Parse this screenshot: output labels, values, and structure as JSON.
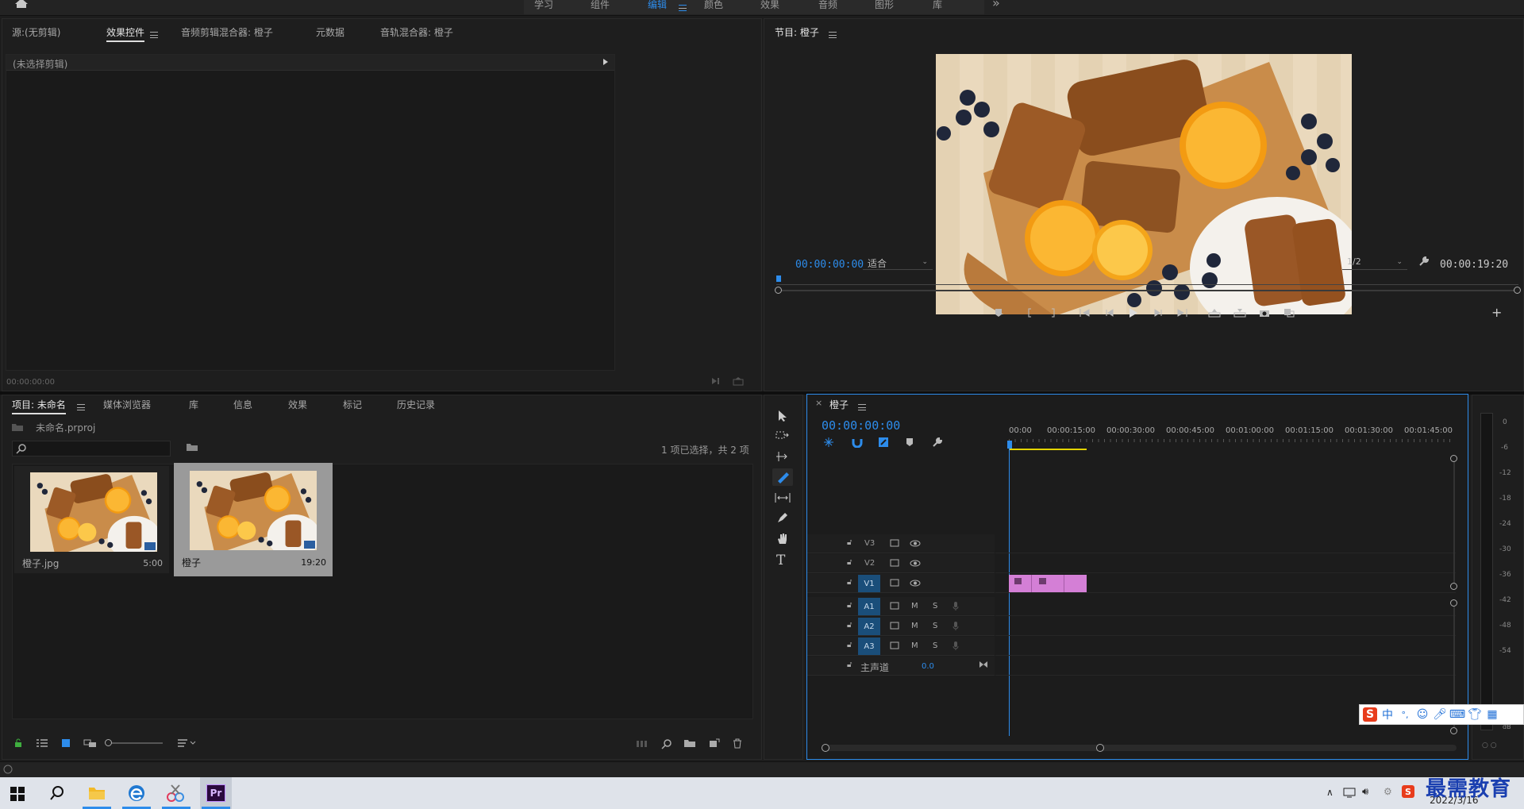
{
  "workspace": {
    "tabs": [
      {
        "label": "学习"
      },
      {
        "label": "组件"
      },
      {
        "label": "编辑"
      },
      {
        "label": "颜色"
      },
      {
        "label": "效果"
      },
      {
        "label": "音频"
      },
      {
        "label": "图形"
      },
      {
        "label": "库"
      }
    ],
    "overflow_label": "»"
  },
  "source_panel": {
    "tabs": [
      {
        "label": "源:(无剪辑)"
      },
      {
        "label": "效果控件"
      },
      {
        "label": "音频剪辑混合器: 橙子"
      },
      {
        "label": "元数据"
      },
      {
        "label": "音轨混合器: 橙子"
      }
    ],
    "no_clip_label": "(未选择剪辑)",
    "timecode": "00:00:00:00"
  },
  "program_monitor": {
    "title": "节目: 橙子",
    "timecode_current": "00:00:00:00",
    "fit_label": "适合",
    "resolution_label": "1/2",
    "timecode_duration": "00:00:19:20"
  },
  "project_panel": {
    "tabs": [
      {
        "label": "项目: 未命名"
      },
      {
        "label": "媒体浏览器"
      },
      {
        "label": "库"
      },
      {
        "label": "信息"
      },
      {
        "label": "效果"
      },
      {
        "label": "标记"
      },
      {
        "label": "历史记录"
      }
    ],
    "project_file": "未命名.prproj",
    "search_placeholder": "",
    "selection_status": "1 项已选择，共 2 项",
    "items": [
      {
        "name": "橙子.jpg",
        "duration": "5:00"
      },
      {
        "name": "橙子",
        "duration": "19:20"
      }
    ]
  },
  "timeline": {
    "sequence_name": "橙子",
    "timecode": "00:00:00:00",
    "ruler": [
      "00:00",
      "00:00:15:00",
      "00:00:30:00",
      "00:00:45:00",
      "00:01:00:00",
      "00:01:15:00",
      "00:01:30:00",
      "00:01:45:00"
    ],
    "video_tracks": [
      {
        "name": "V3"
      },
      {
        "name": "V2"
      },
      {
        "name": "V1"
      }
    ],
    "audio_tracks": [
      {
        "name": "A1",
        "m": "M",
        "s": "S"
      },
      {
        "name": "A2",
        "m": "M",
        "s": "S"
      },
      {
        "name": "A3",
        "m": "M",
        "s": "S"
      }
    ],
    "master": {
      "label": "主声道",
      "value": "0.0"
    },
    "clip_color": "#d47fd6"
  },
  "audio_meter": {
    "scale": [
      "0",
      "-6",
      "-12",
      "-18",
      "-24",
      "-30",
      "-36",
      "-42",
      "-48",
      "-54"
    ],
    "unit": "dB"
  },
  "ime_toolbar": {
    "lang": "中",
    "punct": "°,"
  },
  "taskbar": {
    "apps": [
      {
        "name": "start"
      },
      {
        "name": "search"
      },
      {
        "name": "explorer"
      },
      {
        "name": "edge"
      },
      {
        "name": "snipping"
      },
      {
        "name": "premiere",
        "label": "Pr"
      }
    ],
    "date": "2022/3/16",
    "watermark": "最需教育"
  },
  "colors": {
    "accent": "#2d8ceb",
    "panel_bg": "#1e1e1e",
    "track_active": "#1a4e7a",
    "clip": "#d47fd6",
    "playhead_region": "#e3d400"
  }
}
